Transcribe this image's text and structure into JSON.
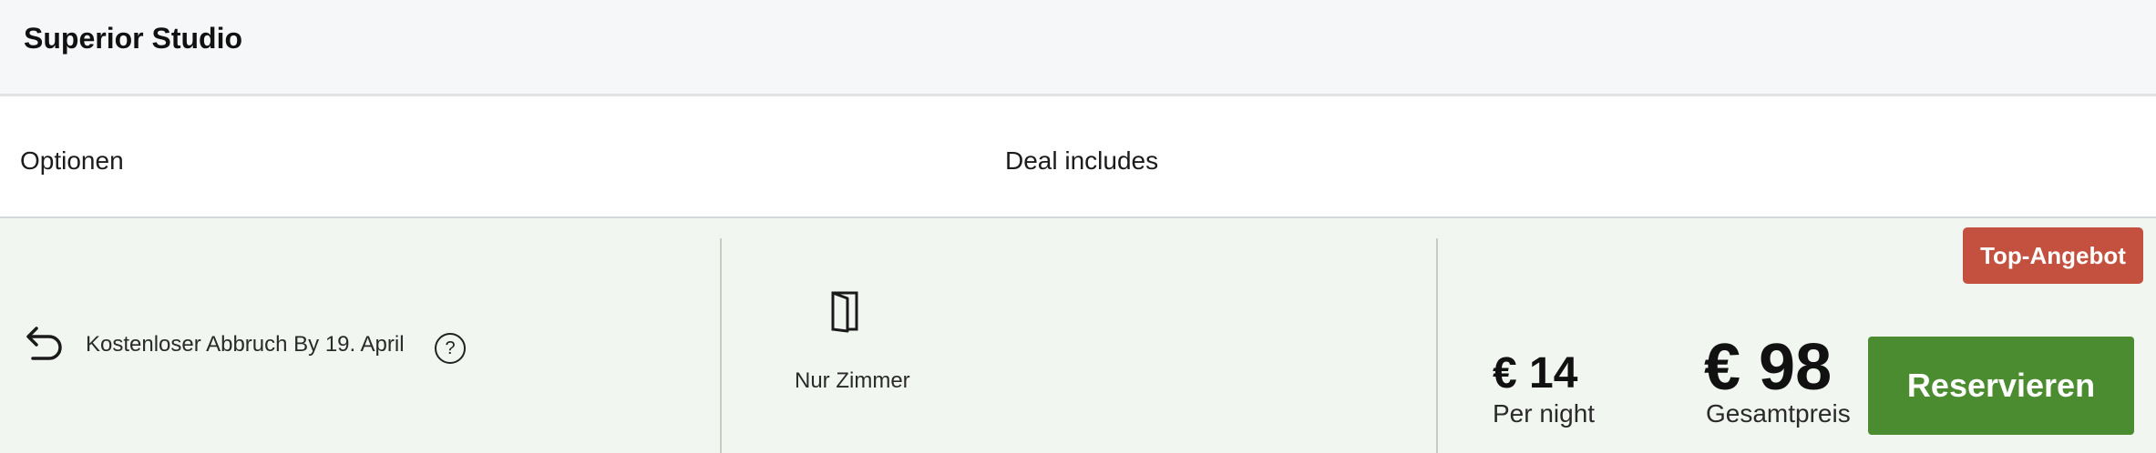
{
  "room": {
    "title": "Superior Studio"
  },
  "columns": {
    "options_label": "Optionen",
    "deal_label": "Deal includes"
  },
  "offer": {
    "cancellation_text": "Kostenloser Abbruch By 19. April",
    "cancellation_icon": "undo-arrow-icon",
    "help_icon": "question-mark-icon",
    "help_glyph": "?",
    "inclusion_icon": "door-icon",
    "inclusion_text": "Nur Zimmer",
    "badge_text": "Top-Angebot",
    "per_night_price": "€ 14",
    "per_night_label": "Per night",
    "total_price": "€ 98",
    "total_label": "Gesamtpreis",
    "reserve_label": "Reservieren"
  },
  "colors": {
    "header_bg": "#f6f7f8",
    "offer_row_bg": "#f1f6f0",
    "badge_bg": "#c4503f",
    "button_bg": "#4a8c2f"
  }
}
